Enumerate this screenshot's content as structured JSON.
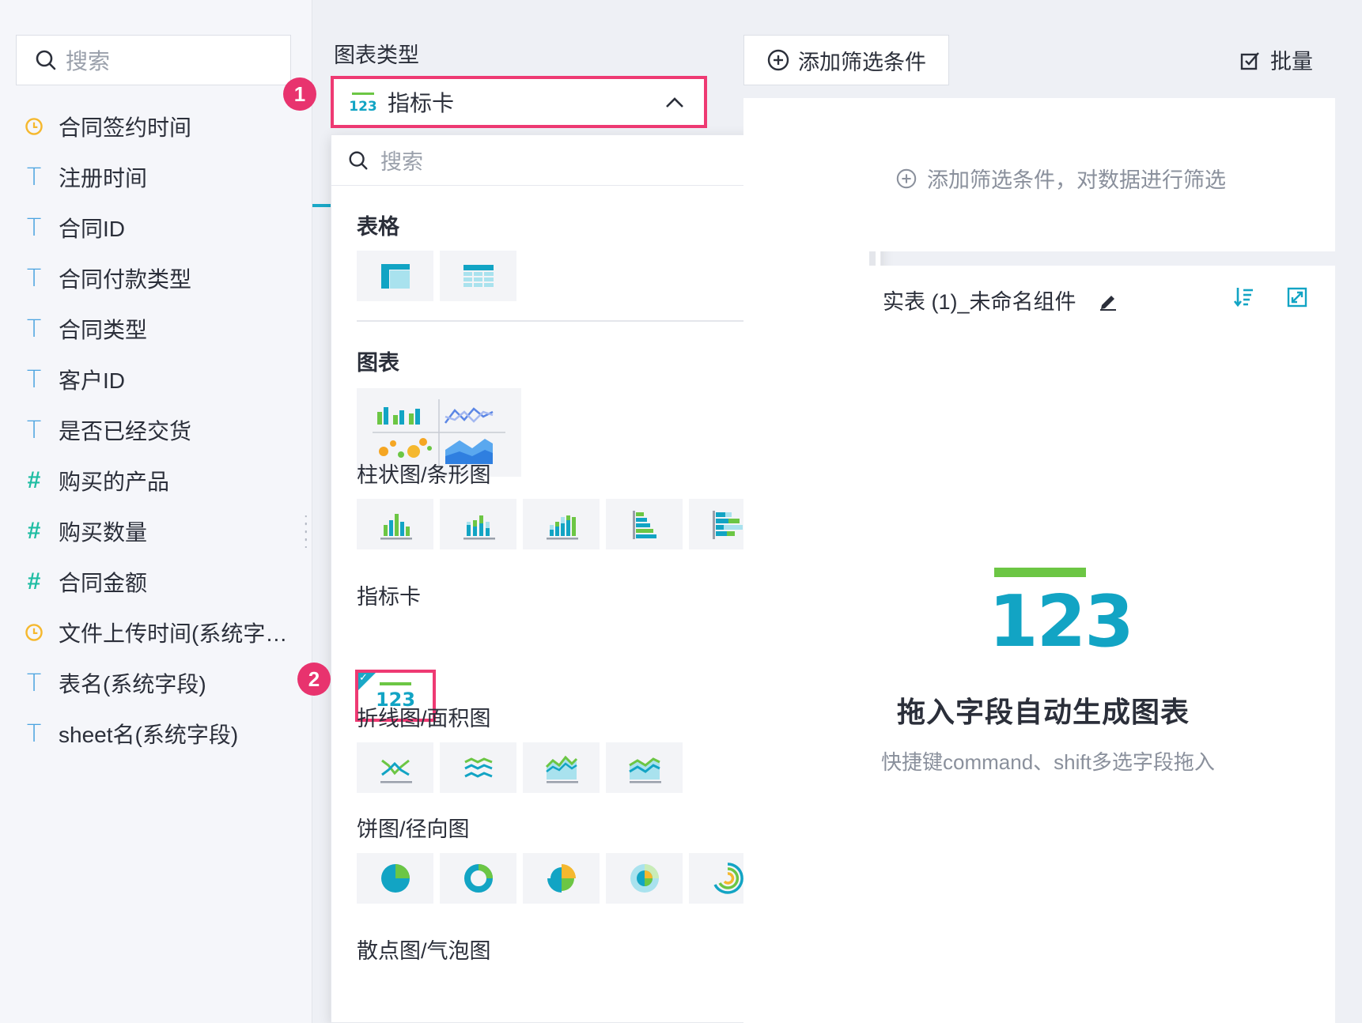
{
  "field_panel": {
    "search_placeholder": "搜索",
    "fields": [
      {
        "type": "date",
        "icon": "clock-icon",
        "label": "合同签约时间"
      },
      {
        "type": "text",
        "icon": "text-type-icon",
        "label": "注册时间"
      },
      {
        "type": "text",
        "icon": "text-type-icon",
        "label": "合同ID"
      },
      {
        "type": "text",
        "icon": "text-type-icon",
        "label": "合同付款类型"
      },
      {
        "type": "text",
        "icon": "text-type-icon",
        "label": "合同类型"
      },
      {
        "type": "text",
        "icon": "text-type-icon",
        "label": "客户ID"
      },
      {
        "type": "text",
        "icon": "text-type-icon",
        "label": "是否已经交货"
      },
      {
        "type": "number",
        "icon": "number-type-icon",
        "label": "购买的产品"
      },
      {
        "type": "number",
        "icon": "number-type-icon",
        "label": "购买数量"
      },
      {
        "type": "number",
        "icon": "number-type-icon",
        "label": "合同金额"
      },
      {
        "type": "date",
        "icon": "clock-icon",
        "label": "文件上传时间(系统字…"
      },
      {
        "type": "text",
        "icon": "text-type-icon",
        "label": "表名(系统字段)"
      },
      {
        "type": "text",
        "icon": "text-type-icon",
        "label": "sheet名(系统字段)"
      }
    ],
    "type_symbols": {
      "text": "T",
      "number": "#"
    }
  },
  "chart_type": {
    "label": "图表类型",
    "selected": "指标卡",
    "selected_icon": "123",
    "step1": "1",
    "step2": "2"
  },
  "dropdown": {
    "search_placeholder": "搜索",
    "sections": {
      "table": "表格",
      "chart": "图表",
      "bar": "柱状图/条形图",
      "kpi": "指标卡",
      "kpi_icon_text": "123",
      "line": "折线图/面积图",
      "pie": "饼图/径向图",
      "scatter": "散点图/气泡图"
    }
  },
  "filter": {
    "add_button": "添加筛选条件",
    "batch_button": "批量",
    "hint": "添加筛选条件，对数据进行筛选"
  },
  "component": {
    "title": "实表 (1)_未命名组件",
    "kpi_placeholder": "123",
    "empty_title": "拖入字段自动生成图表",
    "empty_hint": "快捷键command、shift多选字段拖入"
  },
  "colors": {
    "accent": "#1aa8c7",
    "highlight": "#ee3a73",
    "green": "#6cc644",
    "date_icon": "#f5b82e"
  }
}
